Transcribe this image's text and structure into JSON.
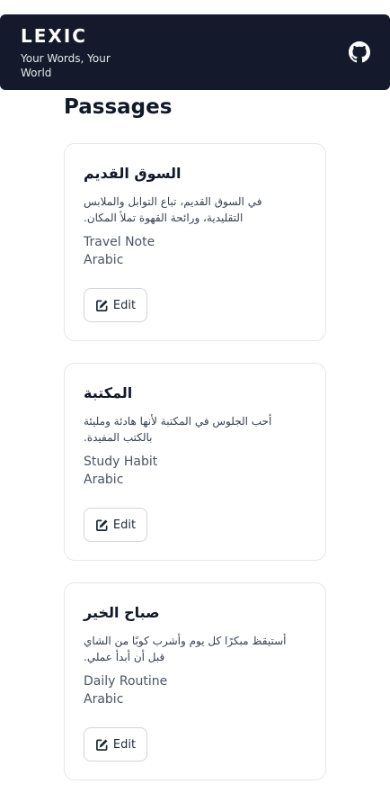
{
  "header": {
    "title": "LEXIC",
    "tagline": "Your Words, Your World",
    "github_icon": "github-icon"
  },
  "page": {
    "title": "Passages"
  },
  "passages": [
    {
      "title": "السوق القديم",
      "text": "في السوق القديم، تباع التوابل والملابس التقليدية، ورائحة القهوة تملأ المكان.",
      "category": "Travel Note",
      "language": "Arabic",
      "edit_label": "Edit"
    },
    {
      "title": "المكتبة",
      "text": "أحب الجلوس في المكتبة لأنها هادئة ومليئة بالكتب المفيدة.",
      "category": "Study Habit",
      "language": "Arabic",
      "edit_label": "Edit"
    },
    {
      "title": "صباح الخير",
      "text": "أستيقظ مبكرًا كل يوم وأشرب كوبًا من الشاي قبل أن أبدأ عملي.",
      "category": "Daily Routine",
      "language": "Arabic",
      "edit_label": "Edit"
    }
  ]
}
